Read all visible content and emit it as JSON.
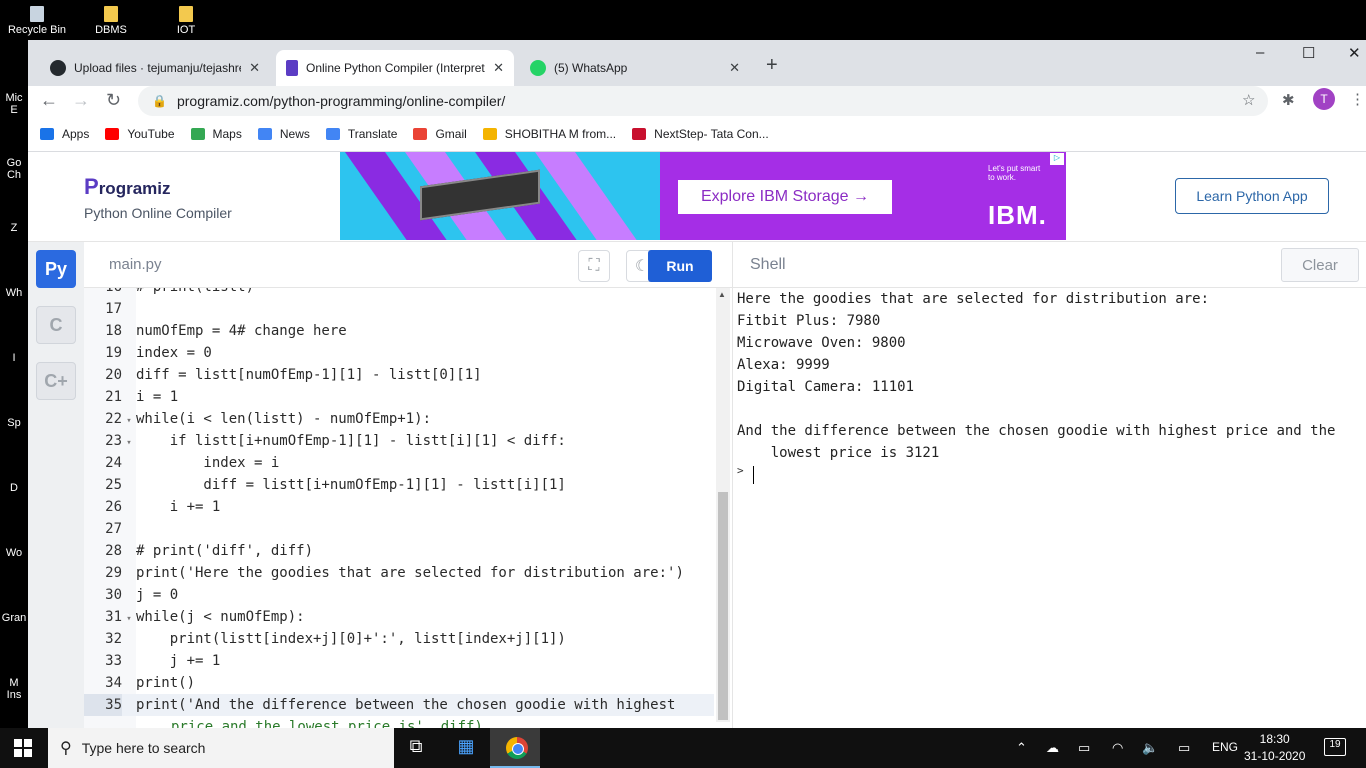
{
  "desktop": {
    "icons": [
      {
        "label": "Recycle Bin"
      },
      {
        "label": "DBMS"
      },
      {
        "label": "IOT"
      }
    ],
    "edge_labels": [
      "Mic\nE",
      "Go\nCh",
      "Z",
      "Wh",
      "I",
      "Sp",
      "D",
      "Wo",
      "Gran",
      "M\nIns"
    ]
  },
  "browser": {
    "tabs": [
      {
        "title": "Upload files · tejumanju/tejashree",
        "icon": "github-icon",
        "color": "#24292e"
      },
      {
        "title": "Online Python Compiler (Interpreter)",
        "icon": "programiz-icon",
        "color": "#5b3cc4",
        "active": true
      },
      {
        "title": "(5) WhatsApp",
        "icon": "whatsapp-icon",
        "color": "#25d366"
      }
    ],
    "url": "programiz.com/python-programming/online-compiler/",
    "profile_initial": "T",
    "bookmarks": [
      {
        "label": "Apps",
        "color": "#1a73e8"
      },
      {
        "label": "YouTube",
        "color": "#ff0000"
      },
      {
        "label": "Maps",
        "color": "#34a853"
      },
      {
        "label": "News",
        "color": "#4285f4"
      },
      {
        "label": "Translate",
        "color": "#4285f4"
      },
      {
        "label": "Gmail",
        "color": "#ea4335"
      },
      {
        "label": "SHOBITHA M from...",
        "color": "#f4b400"
      },
      {
        "label": "NextStep- Tata Con...",
        "color": "#c8102e"
      }
    ]
  },
  "site": {
    "logo": "rogramiz",
    "logo_p": "P",
    "subtitle": "Python Online Compiler",
    "ad": {
      "button": "Explore IBM Storage  →",
      "small_text": "Let's put smart to work.",
      "brand": "IBM."
    },
    "learn_button": "Learn Python App"
  },
  "editor": {
    "file_name": "main.py",
    "run_label": "Run",
    "lines": [
      {
        "n": "16",
        "fold": "",
        "code": "# print(listt)"
      },
      {
        "n": "17",
        "fold": "",
        "code": ""
      },
      {
        "n": "18",
        "fold": "",
        "code": "numOfEmp = 4# change here"
      },
      {
        "n": "19",
        "fold": "",
        "code": "index = 0"
      },
      {
        "n": "20",
        "fold": "",
        "code": "diff = listt[numOfEmp-1][1] - listt[0][1]"
      },
      {
        "n": "21",
        "fold": "",
        "code": "i = 1"
      },
      {
        "n": "22",
        "fold": "▾",
        "code": "while(i < len(listt) - numOfEmp+1):"
      },
      {
        "n": "23",
        "fold": "▾",
        "code": "    if listt[i+numOfEmp-1][1] - listt[i][1] < diff:"
      },
      {
        "n": "24",
        "fold": "",
        "code": "        index = i"
      },
      {
        "n": "25",
        "fold": "",
        "code": "        diff = listt[i+numOfEmp-1][1] - listt[i][1]"
      },
      {
        "n": "26",
        "fold": "",
        "code": "    i += 1"
      },
      {
        "n": "27",
        "fold": "",
        "code": ""
      },
      {
        "n": "28",
        "fold": "",
        "code": "# print('diff', diff)"
      },
      {
        "n": "29",
        "fold": "",
        "code": "print('Here the goodies that are selected for distribution are:')"
      },
      {
        "n": "30",
        "fold": "",
        "code": "j = 0"
      },
      {
        "n": "31",
        "fold": "▾",
        "code": "while(j < numOfEmp):"
      },
      {
        "n": "32",
        "fold": "",
        "code": "    print(listt[index+j][0]+':', listt[index+j][1])"
      },
      {
        "n": "33",
        "fold": "",
        "code": "    j += 1"
      },
      {
        "n": "34",
        "fold": "",
        "code": "print()"
      },
      {
        "n": "35",
        "fold": "",
        "code": "print('And the difference between the chosen goodie with highest"
      }
    ],
    "wrap_line": "price and the lowest price is', diff)"
  },
  "shell": {
    "title": "Shell",
    "clear_label": "Clear",
    "output": [
      "Here the goodies that are selected for distribution are:",
      "Fitbit Plus: 7980",
      "Microwave Oven: 9800",
      "Alexa: 9999",
      "Digital Camera: 11101",
      "",
      "And the difference between the chosen goodie with highest price and the",
      "    lowest price is 3121"
    ],
    "prompt": ">"
  },
  "taskbar": {
    "search_placeholder": "Type here to search",
    "language": "ENG",
    "time": "18:30",
    "date": "31-10-2020",
    "notifications": "19"
  }
}
